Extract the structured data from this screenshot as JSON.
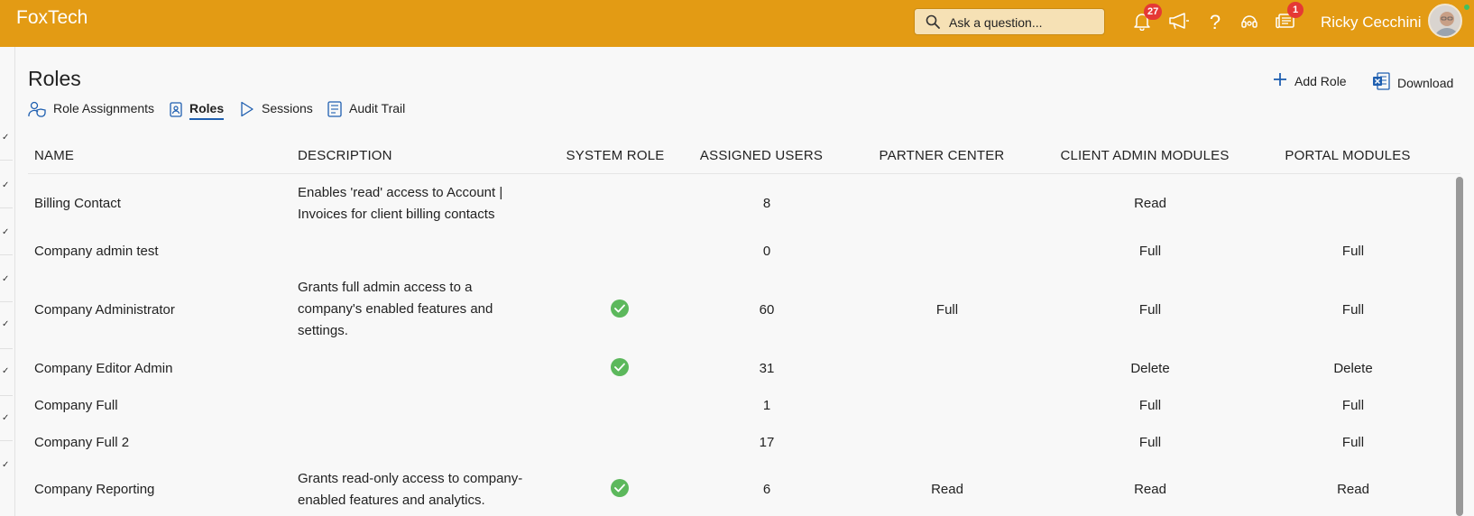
{
  "app": {
    "brand": "FoxTech"
  },
  "topbar": {
    "search_placeholder": "Ask a question...",
    "notifications_count": "27",
    "inbox_count": "1",
    "user_name": "Ricky Cecchini"
  },
  "page": {
    "title": "Roles",
    "actions": {
      "add_role": "Add Role",
      "download": "Download"
    },
    "tabs": [
      {
        "label": "Role Assignments",
        "active": false
      },
      {
        "label": "Roles",
        "active": true
      },
      {
        "label": "Sessions",
        "active": false
      },
      {
        "label": "Audit Trail",
        "active": false
      }
    ]
  },
  "table": {
    "columns": [
      "NAME",
      "DESCRIPTION",
      "SYSTEM ROLE",
      "ASSIGNED USERS",
      "PARTNER CENTER",
      "CLIENT ADMIN MODULES",
      "PORTAL MODULES"
    ],
    "rows": [
      {
        "name": "Billing Contact",
        "description": "Enables 'read' access to Account | Invoices for client billing contacts",
        "system_role": false,
        "assigned_users": "8",
        "partner_center": "",
        "client_admin_modules": "Read",
        "portal_modules": ""
      },
      {
        "name": "Company admin test",
        "description": "",
        "system_role": false,
        "assigned_users": "0",
        "partner_center": "",
        "client_admin_modules": "Full",
        "portal_modules": "Full"
      },
      {
        "name": "Company Administrator",
        "description": "Grants full admin access to a company's enabled features and settings.",
        "system_role": true,
        "assigned_users": "60",
        "partner_center": "Full",
        "client_admin_modules": "Full",
        "portal_modules": "Full"
      },
      {
        "name": "Company Editor Admin",
        "description": "",
        "system_role": true,
        "assigned_users": "31",
        "partner_center": "",
        "client_admin_modules": "Delete",
        "portal_modules": "Delete"
      },
      {
        "name": "Company Full",
        "description": "",
        "system_role": false,
        "assigned_users": "1",
        "partner_center": "",
        "client_admin_modules": "Full",
        "portal_modules": "Full"
      },
      {
        "name": "Company Full 2",
        "description": "",
        "system_role": false,
        "assigned_users": "17",
        "partner_center": "",
        "client_admin_modules": "Full",
        "portal_modules": "Full"
      },
      {
        "name": "Company Reporting",
        "description": "Grants read-only access to company-enabled features and analytics.",
        "system_role": true,
        "assigned_users": "6",
        "partner_center": "Read",
        "client_admin_modules": "Read",
        "portal_modules": "Read"
      }
    ]
  },
  "colors": {
    "topbar": "#e39b14",
    "accent": "#1f5fb0",
    "check": "#5cb85c",
    "badge": "#e53935"
  }
}
